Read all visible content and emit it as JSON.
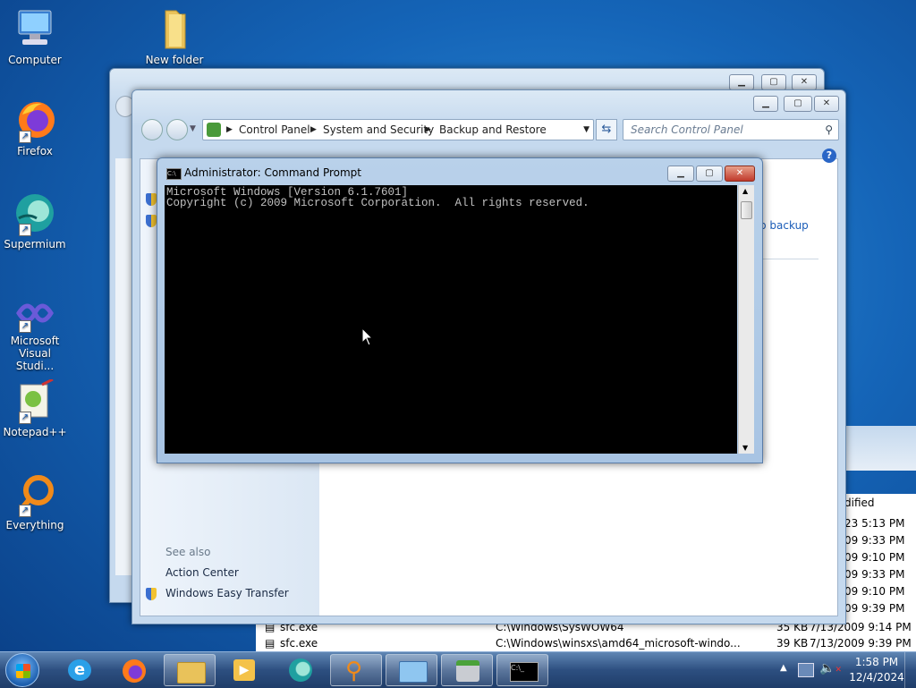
{
  "desktop": {
    "icons": [
      {
        "label": "Computer"
      },
      {
        "label": "New folder"
      },
      {
        "label": "Firefox"
      },
      {
        "label": "Supermium"
      },
      {
        "label": "Microsoft Visual Studi..."
      },
      {
        "label": "Notepad++"
      },
      {
        "label": "Everything"
      }
    ]
  },
  "explorer_back": {
    "column_header": "dified",
    "rows": [
      {
        "name": "sfc.exe",
        "path": "C:\\Windows\\SysWOW64",
        "size": "35 KB",
        "modified": "7/13/2009 9:14 PM"
      },
      {
        "name": "sfc.exe",
        "path": "C:\\Windows\\winsxs\\amd64_microsoft-windo...",
        "size": "39 KB",
        "modified": "7/13/2009 9:39 PM"
      }
    ],
    "partial_times": [
      "23 5:13 PM",
      "09 9:33 PM",
      "09 9:10 PM",
      "09 9:33 PM",
      "09 9:10 PM",
      "09 9:39 PM"
    ]
  },
  "control_panel": {
    "breadcrumb": [
      "Control Panel",
      "System and Security",
      "Backup and Restore"
    ],
    "search_placeholder": "Search Control Panel",
    "right_link_partial": "p backup",
    "see_also": "See also",
    "links": [
      "Action Center",
      "Windows Easy Transfer"
    ]
  },
  "cmd": {
    "title": "Administrator: Command Prompt",
    "line1": "Microsoft Windows [Version 6.1.7601]",
    "line2": "Copyright (c) 2009 Microsoft Corporation.  All rights reserved."
  },
  "taskbar": {
    "time": "1:58 PM",
    "date": "12/4/2024"
  }
}
